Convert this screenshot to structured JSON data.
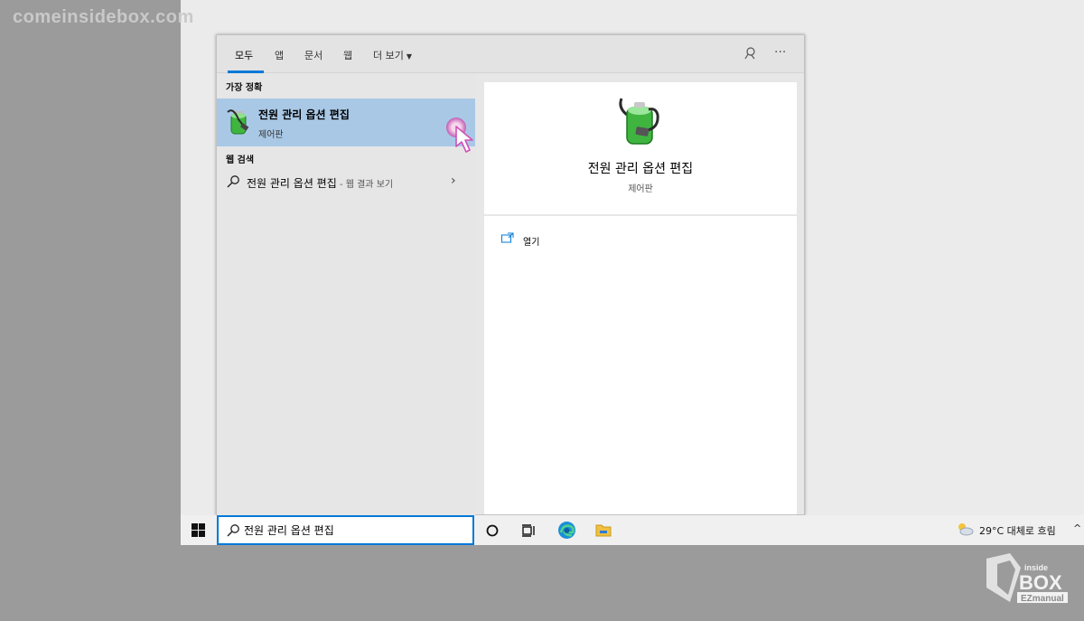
{
  "watermark": "comeinsidebox.com",
  "tabs": [
    {
      "label": "모두",
      "active": true
    },
    {
      "label": "앱"
    },
    {
      "label": "문서"
    },
    {
      "label": "웹"
    },
    {
      "label": "더 보기"
    }
  ],
  "toolbar_icons": [
    "feedback-icon",
    "more-options-icon"
  ],
  "more_icon_text": "···",
  "left": {
    "best_match_label": "가장 정확",
    "best_match": {
      "title": "전원 관리 옵션 편집",
      "subtitle": "제어판",
      "icon": "battery-power-icon"
    },
    "web_label": "웹 검색",
    "web_result": {
      "title": "전원 관리 옵션 편집",
      "suffix": " - 웹 결과 보기",
      "chevron": "›"
    }
  },
  "detail": {
    "title": "전원 관리 옵션 편집",
    "subtitle": "제어판",
    "actions": [
      {
        "label": "열기",
        "icon": "open-icon"
      }
    ]
  },
  "taskbar": {
    "search_value": "전원 관리 옵션 편집",
    "apps": [
      "cortana-icon",
      "task-view-icon",
      "edge-icon",
      "file-explorer-icon"
    ],
    "weather": "29°C 대체로 흐림",
    "tray_arrow": "^"
  },
  "logo": {
    "line1": "inside",
    "line2": "BOX",
    "line3": "EZmanual"
  },
  "colors": {
    "accent": "#0078d7",
    "selection": "#a9c8e6"
  }
}
